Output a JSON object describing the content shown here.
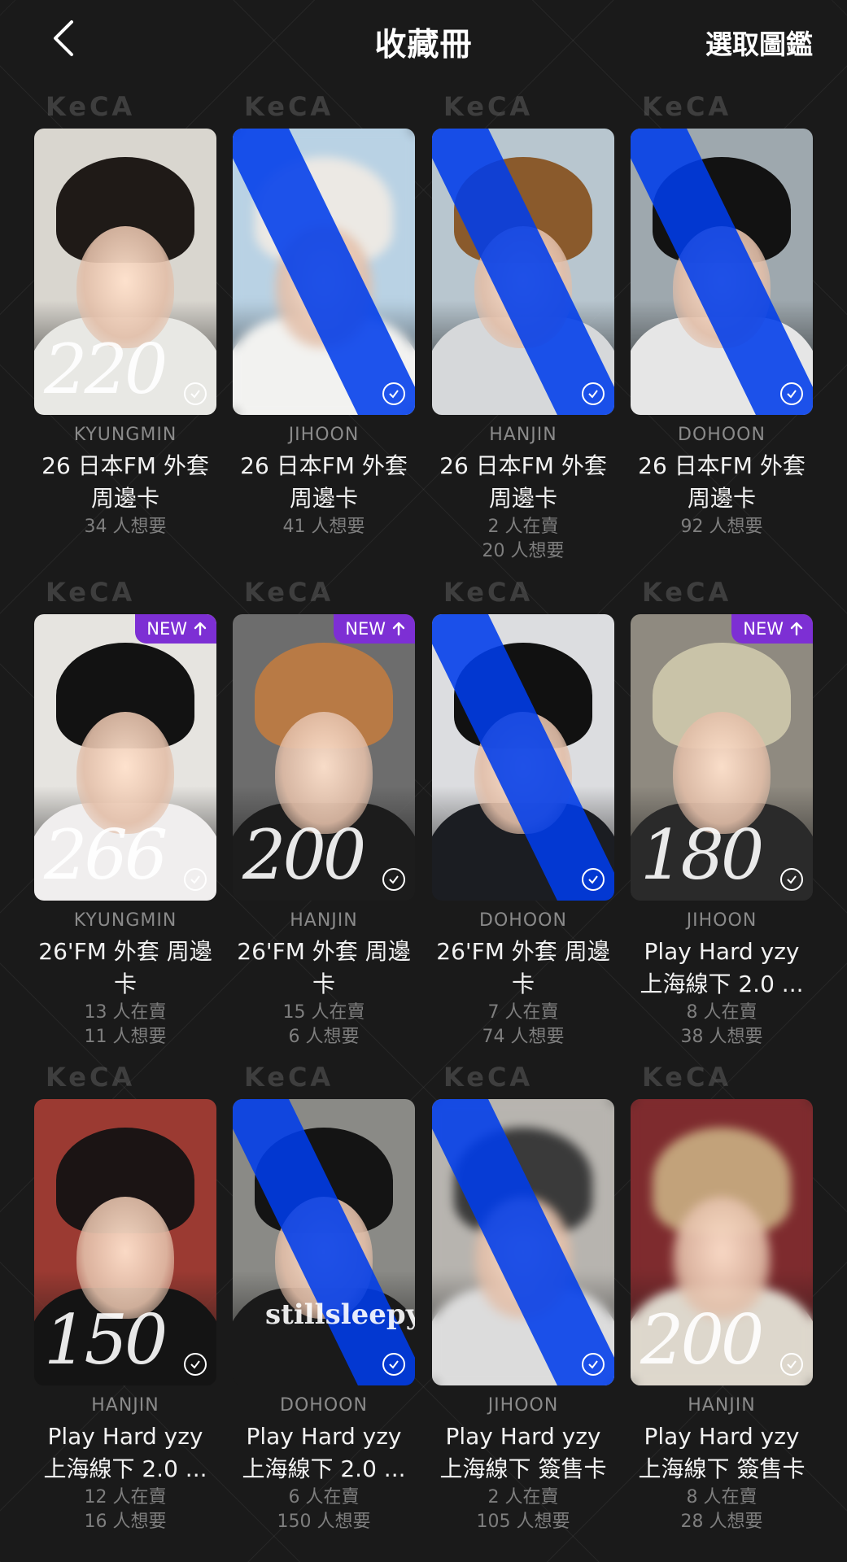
{
  "header": {
    "title": "收藏冊",
    "action": "選取圖鑑"
  },
  "watermark": "KeCA",
  "colors": {
    "background": "#1a1a1a",
    "new_badge": "#7d2fd4",
    "cover_stripe": "#003ceb"
  },
  "cards": [
    {
      "member": "KYUNGMIN",
      "title_line1": "26 日本FM 外套",
      "title_line2": "周邊卡",
      "stat1": "34 人想要",
      "stat2": "",
      "new_label": "",
      "note": "220",
      "covered": false,
      "blurred": false
    },
    {
      "member": "JIHOON",
      "title_line1": "26 日本FM 外套",
      "title_line2": "周邊卡",
      "stat1": "41 人想要",
      "stat2": "",
      "new_label": "",
      "note": "",
      "covered": true,
      "blurred": true
    },
    {
      "member": "HANJIN",
      "title_line1": "26 日本FM 外套",
      "title_line2": "周邊卡",
      "stat1": "2 人在賣",
      "stat2": "20 人想要",
      "new_label": "",
      "note": "",
      "covered": true,
      "blurred": false
    },
    {
      "member": "DOHOON",
      "title_line1": "26 日本FM 外套",
      "title_line2": "周邊卡",
      "stat1": "92 人想要",
      "stat2": "",
      "new_label": "",
      "note": "",
      "covered": true,
      "blurred": false
    },
    {
      "member": "KYUNGMIN",
      "title_line1": "26'FM 外套 周邊",
      "title_line2": "卡",
      "stat1": "13 人在賣",
      "stat2": "11 人想要",
      "new_label": "NEW",
      "note": "266",
      "covered": false,
      "blurred": false
    },
    {
      "member": "HANJIN",
      "title_line1": "26'FM 外套 周邊",
      "title_line2": "卡",
      "stat1": "15 人在賣",
      "stat2": "6 人想要",
      "new_label": "NEW",
      "note": "200",
      "covered": false,
      "blurred": false
    },
    {
      "member": "DOHOON",
      "title_line1": "26'FM 外套 周邊",
      "title_line2": "卡",
      "stat1": "7 人在賣",
      "stat2": "74 人想要",
      "new_label": "",
      "note": "",
      "covered": true,
      "blurred": false
    },
    {
      "member": "JIHOON",
      "title_line1": "Play Hard yzy",
      "title_line2": "上海線下 2.0 ...",
      "stat1": "8 人在賣",
      "stat2": "38 人想要",
      "new_label": "NEW",
      "note": "180",
      "covered": false,
      "blurred": false
    },
    {
      "member": "HANJIN",
      "title_line1": "Play Hard yzy",
      "title_line2": "上海線下 2.0 ...",
      "stat1": "12 人在賣",
      "stat2": "16 人想要",
      "new_label": "",
      "note": "150",
      "covered": false,
      "blurred": false
    },
    {
      "member": "DOHOON",
      "title_line1": "Play Hard yzy",
      "title_line2": "上海線下 2.0 ...",
      "stat1": "6 人在賣",
      "stat2": "150 人想要",
      "new_label": "",
      "note": "stillsleepy",
      "covered": true,
      "blurred": false
    },
    {
      "member": "JIHOON",
      "title_line1": "Play Hard yzy",
      "title_line2": "上海線下 簽售卡",
      "stat1": "2 人在賣",
      "stat2": "105 人想要",
      "new_label": "",
      "note": "",
      "covered": true,
      "blurred": true
    },
    {
      "member": "HANJIN",
      "title_line1": "Play Hard yzy",
      "title_line2": "上海線下 簽售卡",
      "stat1": "8 人在賣",
      "stat2": "28 人想要",
      "new_label": "",
      "note": "200",
      "covered": false,
      "blurred": true
    }
  ]
}
